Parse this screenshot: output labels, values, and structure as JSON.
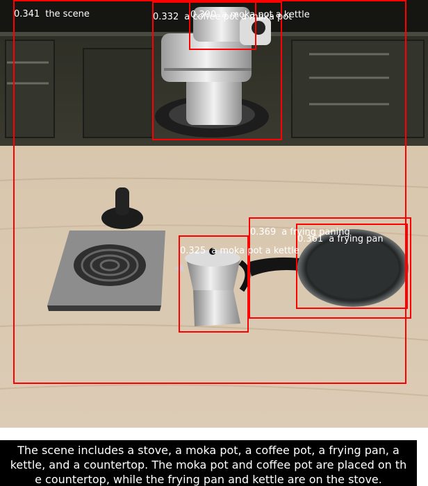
{
  "detections": [
    {
      "score": "0.341",
      "label": "the scene"
    },
    {
      "score": "0.332",
      "label": "a coffee pot a moka pot"
    },
    {
      "score": "0.300",
      "label": "a moka pot a kettle"
    },
    {
      "score": "0.369",
      "label": "a frying paning"
    },
    {
      "score": "0.361",
      "label": "a frying pan"
    },
    {
      "score": "0.325",
      "label": "a moka pot a kettle"
    }
  ],
  "caption": {
    "line1": "The scene includes a stove, a moka pot, a coffee pot, a frying pan, a",
    "line2": "kettle, and a countertop. The moka pot and coffee pot are placed on th",
    "line3": "e countertop, while the frying pan and kettle are on the stove."
  },
  "colors": {
    "box": "#ff0000",
    "label_text": "#ffffff",
    "caption_bg": "#000000"
  }
}
